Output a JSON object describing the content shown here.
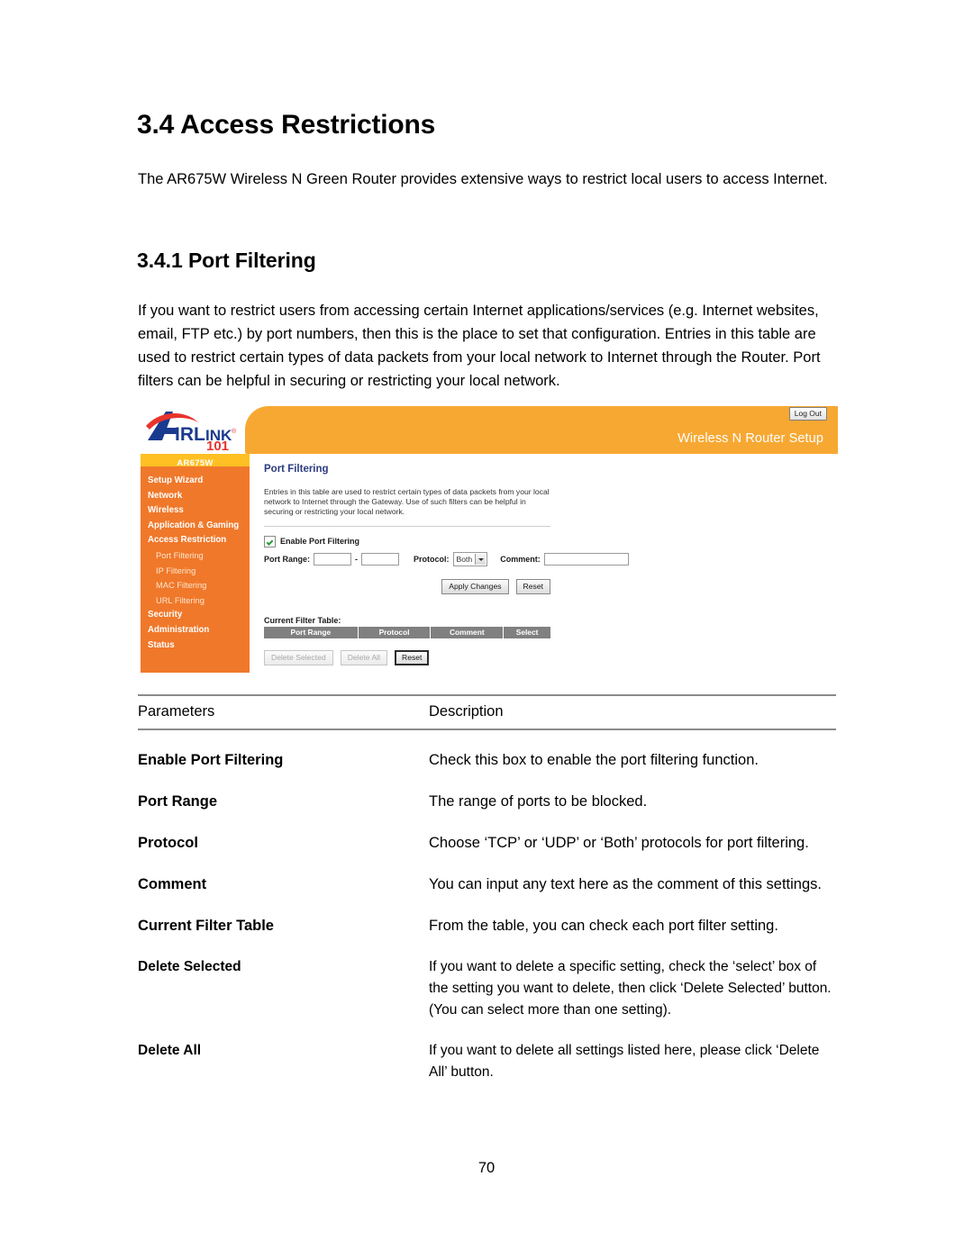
{
  "document": {
    "section_heading": "3.4 Access Restrictions",
    "intro_paragraph": "The AR675W Wireless N Green Router provides extensive ways to restrict local users to access Internet.",
    "subsection_heading": "3.4.1 Port Filtering",
    "subsection_paragraph": "If you want to restrict users from accessing certain Internet applications/services (e.g. Internet websites, email, FTP etc.) by port numbers, then this is the place to set that configuration. Entries in this table are used to restrict certain types of data packets from your local network to Internet through the Router. Port filters can be helpful in securing or restricting your local network.",
    "page_number": "70"
  },
  "router_ui": {
    "brand": {
      "name": "AIRLINK",
      "sub": "101",
      "registered_mark": "®"
    },
    "header": {
      "title": "Wireless N Router Setup",
      "logout_label": "Log Out"
    },
    "sidebar": {
      "model": "AR675W",
      "items": [
        {
          "label": "Setup Wizard",
          "type": "top"
        },
        {
          "label": "Network",
          "type": "top"
        },
        {
          "label": "Wireless",
          "type": "top"
        },
        {
          "label": "Application & Gaming",
          "type": "top"
        },
        {
          "label": "Access Restriction",
          "type": "top"
        },
        {
          "label": "Port Filtering",
          "type": "sub"
        },
        {
          "label": "IP Filtering",
          "type": "sub"
        },
        {
          "label": "MAC Filtering",
          "type": "sub"
        },
        {
          "label": "URL Filtering",
          "type": "sub"
        },
        {
          "label": "Security",
          "type": "top"
        },
        {
          "label": "Administration",
          "type": "top"
        },
        {
          "label": "Status",
          "type": "top"
        }
      ]
    },
    "panel": {
      "title": "Port Filtering",
      "description": "Entries in this table are used to restrict certain types of data packets from your local network to Internet through the Gateway. Use of such filters can be helpful in securing or restricting your local network.",
      "enable_checkbox_label": "Enable Port Filtering",
      "enable_checkbox_checked": true,
      "port_range_label": "Port Range:",
      "port_range_start_value": "",
      "port_range_end_value": "",
      "port_range_separator": "-",
      "protocol_label": "Protocol:",
      "protocol_value": "Both",
      "protocol_options": [
        "TCP",
        "UDP",
        "Both"
      ],
      "comment_label": "Comment:",
      "comment_value": "",
      "apply_button": "Apply Changes",
      "reset_button": "Reset",
      "current_filter_table_label": "Current Filter Table:",
      "table_headers": [
        "Port Range",
        "Protocol",
        "Comment",
        "Select"
      ],
      "table_rows": [],
      "delete_selected_button": "Delete Selected",
      "delete_all_button": "Delete All",
      "table_reset_button": "Reset"
    },
    "colors": {
      "sidebar_orange": "#f0782a",
      "header_orange": "#f7a832",
      "model_band": "#ffc024",
      "panel_title_blue": "#2c3b80",
      "table_header_gray": "#808080",
      "logo_blue": "#1a3a8f",
      "logo_red": "#e8342c"
    }
  },
  "parameters_table": {
    "header": {
      "parameters": "Parameters",
      "description": "Description"
    },
    "rows": [
      {
        "name": "Enable Port Filtering",
        "description": "Check this box to enable the port filtering function."
      },
      {
        "name": "Port Range",
        "description": "The range of ports to be blocked."
      },
      {
        "name": "Protocol",
        "description": "Choose ‘TCP’ or ‘UDP’ or ‘Both’ protocols for port filtering."
      },
      {
        "name": "Comment",
        "description": "You can input any text here as the comment of this settings."
      },
      {
        "name": "Current Filter Table",
        "description": "From the table, you can check each port filter setting."
      },
      {
        "name": "Delete Selected",
        "description": "If you want to delete a specific setting, check the ‘select’ box of the setting you want to delete, then click ‘Delete Selected’ button. (You can select more than one setting)."
      },
      {
        "name": "Delete All",
        "description": "If you want to delete all settings listed here, please click ‘Delete All’ button."
      }
    ]
  }
}
